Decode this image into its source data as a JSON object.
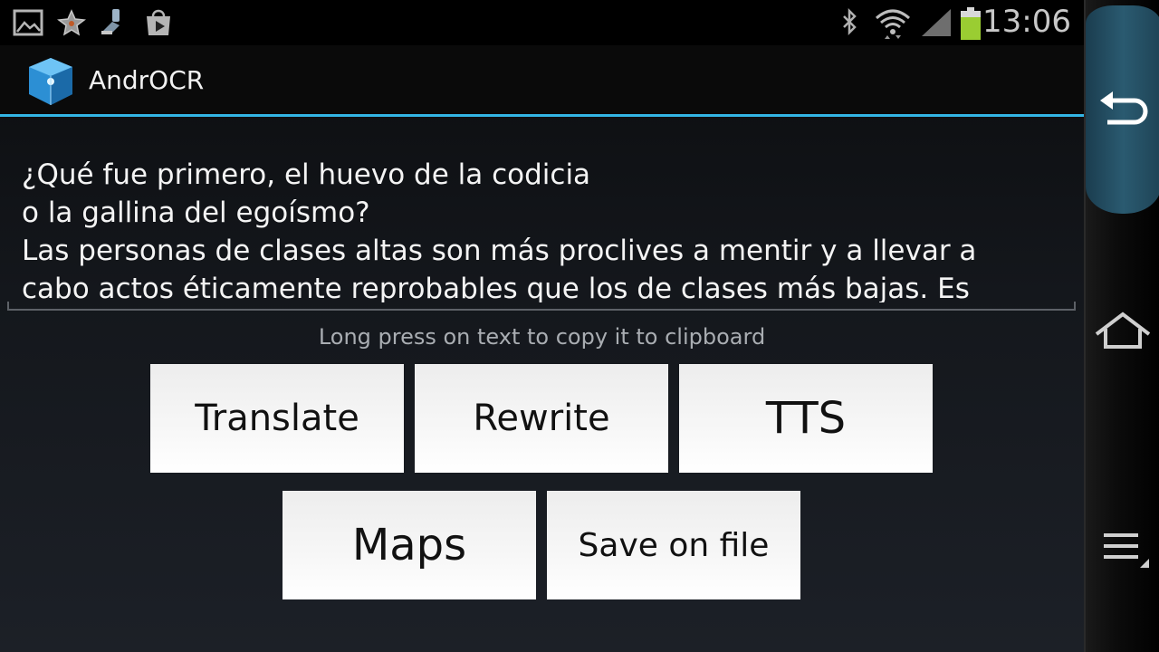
{
  "status_bar": {
    "time": "13:06",
    "notification_icons": [
      "gallery-icon",
      "star-icon",
      "usb-debug-icon",
      "play-store-icon"
    ],
    "system_icons": [
      "bluetooth-icon",
      "wifi-icon",
      "signal-icon",
      "battery-icon"
    ]
  },
  "action_bar": {
    "app_name": "AndrOCR",
    "icon": "cube-icon",
    "accent": "#33b5e5"
  },
  "main": {
    "ocr_text": "¿Qué fue primero, el huevo de la codicia\no la gallina del egoísmo?\nLas personas de clases altas son más proclives a mentir y a llevar a\ncabo actos éticamente reprobables que los de clases más bajas. Es",
    "hint": "Long press on text to copy it to clipboard"
  },
  "buttons": {
    "translate": "Translate",
    "rewrite": "Rewrite",
    "tts": "TTS",
    "maps": "Maps",
    "save": "Save on file"
  },
  "nav_bar": {
    "items": [
      "back-icon",
      "home-icon",
      "menu-icon"
    ]
  }
}
